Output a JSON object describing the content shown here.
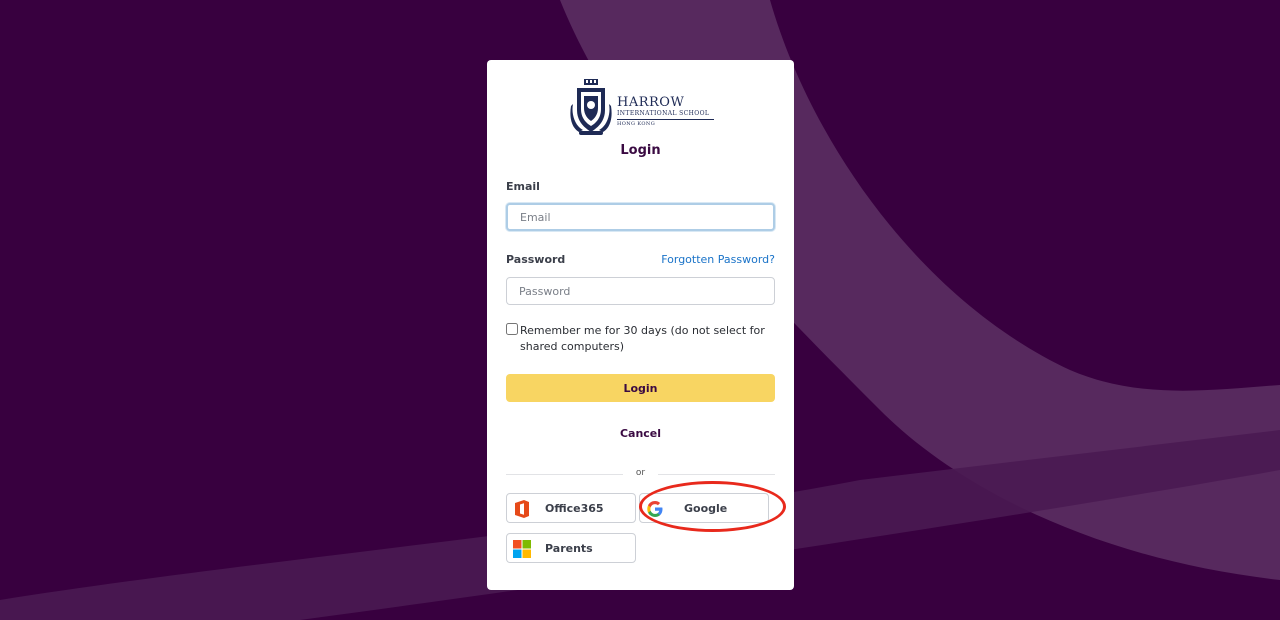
{
  "brand": {
    "name": "HARROW",
    "subtitle": "INTERNATIONAL SCHOOL",
    "city": "HONG KONG"
  },
  "login_form": {
    "title": "Login",
    "email_label": "Email",
    "email_placeholder": "Email",
    "email_value": "",
    "password_label": "Password",
    "password_placeholder": "Password",
    "password_value": "",
    "forgot_link": "Forgotten Password?",
    "remember_label": "Remember me for 30 days (do not select for shared computers)",
    "remember_checked": false,
    "login_button": "Login",
    "cancel_link": "Cancel",
    "divider_text": "or"
  },
  "sso": [
    {
      "label": "Office365",
      "icon": "office365-icon"
    },
    {
      "label": "Google",
      "icon": "google-icon"
    },
    {
      "label": "Parents",
      "icon": "microsoft-icon"
    }
  ],
  "colors": {
    "background": "#38003f",
    "login_button": "#f8d562",
    "link": "#1a73c8",
    "annotation": "#e8291c"
  }
}
